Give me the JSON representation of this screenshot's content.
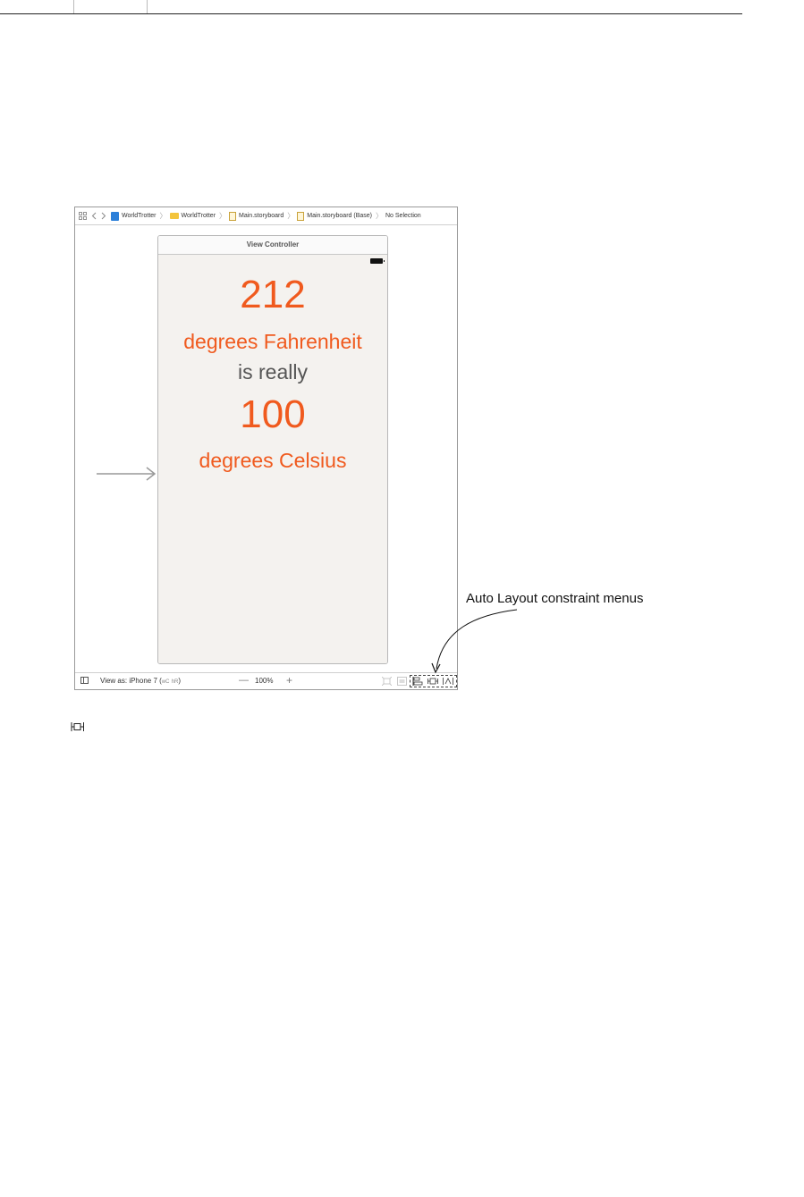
{
  "jump_bar": {
    "items": [
      "WorldTrotter",
      "WorldTrotter",
      "Main.storyboard",
      "Main.storyboard (Base)",
      "No Selection"
    ]
  },
  "scene": {
    "title": "View Controller",
    "fahrenheit_value": "212",
    "fahrenheit_label": "degrees Fahrenheit",
    "connector_label": "is really",
    "celsius_value": "100",
    "celsius_label": "degrees Celsius"
  },
  "bottom_bar": {
    "view_as_prefix": "View as: iPhone 7 (",
    "size_class_w": "wC",
    "size_class_h": "hR",
    "view_as_suffix": ")",
    "zoom": "100%"
  },
  "annotation": {
    "text": "Auto Layout constraint menus"
  },
  "colors": {
    "accent_orange": "#f05a1e",
    "text_gray": "#555555",
    "view_background": "#f4f2ef"
  }
}
